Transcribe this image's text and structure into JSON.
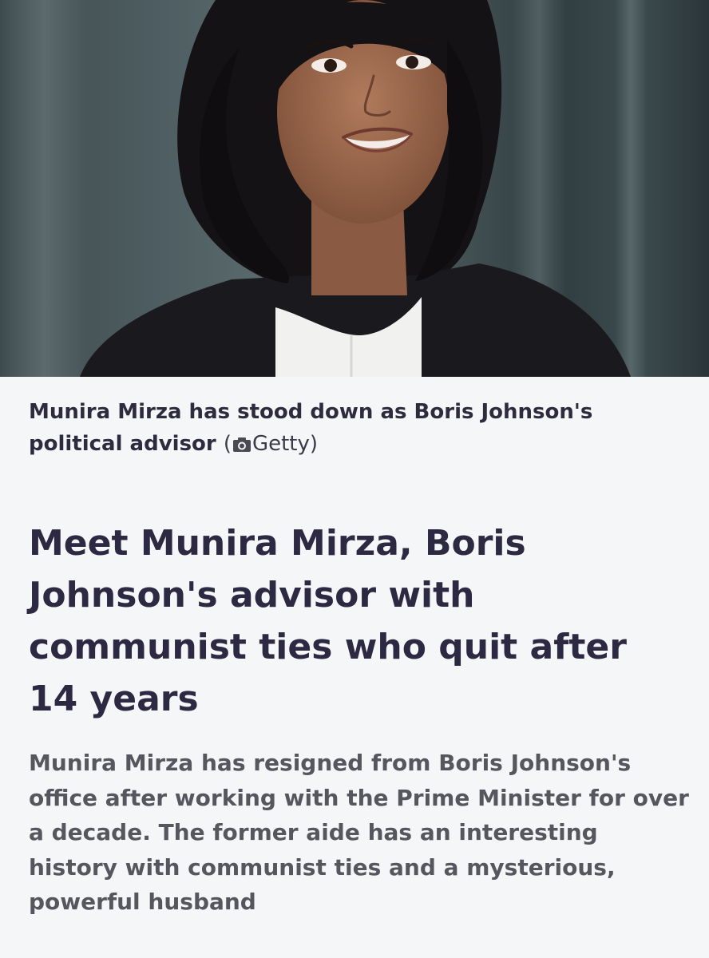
{
  "photo": {
    "subject": "woman-portrait-photo"
  },
  "caption": {
    "text": "Munira Mirza has stood down as Boris Johnson's political advisor",
    "credit_open": "(",
    "credit_icon": "camera-icon",
    "credit_text": "Getty)"
  },
  "article": {
    "headline": "Meet Munira Mirza, Boris Johnson's advisor with communist ties who quit after 14 years",
    "standfirst": "Munira Mirza has resigned from Boris Johnson's office after working with the Prime Minister for over a decade. The former aide has an interesting history with communist ties and a mysterious, powerful husband"
  },
  "colors": {
    "background": "#f5f6f7",
    "headline": "#2d2942",
    "standfirst": "#56565f"
  }
}
